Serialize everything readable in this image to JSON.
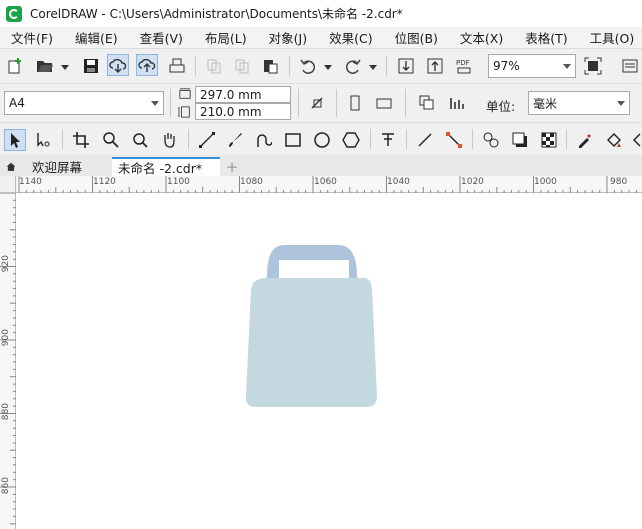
{
  "window": {
    "title": "CorelDRAW - C:\\Users\\Administrator\\Documents\\未命名 -2.cdr*"
  },
  "menu": [
    "文件(F)",
    "编辑(E)",
    "查看(V)",
    "布局(L)",
    "对象(J)",
    "效果(C)",
    "位图(B)",
    "文本(X)",
    "表格(T)",
    "工具(O)"
  ],
  "toolbar": {
    "zoom": "97%"
  },
  "property_bar": {
    "page_size": "A4",
    "width": "297.0 mm",
    "height": "210.0 mm",
    "units_label": "单位:",
    "units_value": "毫米"
  },
  "tabs": {
    "welcome": "欢迎屏幕",
    "document": "未命名 -2.cdr*",
    "add": "+"
  },
  "rulers": {
    "horizontal": [
      "1140",
      "1120",
      "1100",
      "1080",
      "1060",
      "1040",
      "1020",
      "1000",
      "980"
    ],
    "vertical": [
      "920",
      "900",
      "880",
      "860"
    ]
  },
  "colors": {
    "bag_body": "#c3d8df",
    "bag_handle": "#aec4dc",
    "tab_accent": "#2f8fd8"
  }
}
